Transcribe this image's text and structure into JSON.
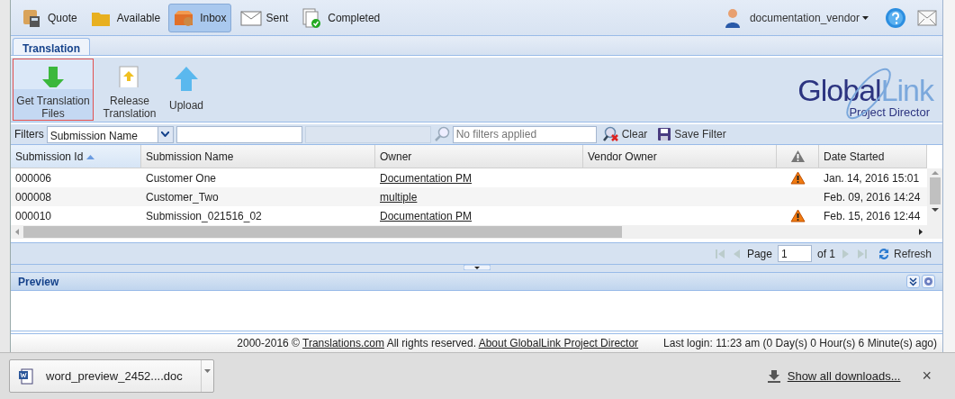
{
  "nav": {
    "items": [
      {
        "label": "Quote",
        "selected": false
      },
      {
        "label": "Available",
        "selected": false
      },
      {
        "label": "Inbox",
        "selected": true
      },
      {
        "label": "Sent",
        "selected": false
      },
      {
        "label": "Completed",
        "selected": false
      }
    ],
    "user": "documentation_vendor"
  },
  "tabs": [
    {
      "label": "Translation",
      "selected": true
    }
  ],
  "toolbar": {
    "buttons": [
      {
        "label": "Get Translation Files",
        "focused": true
      },
      {
        "label": "Release Translation",
        "focused": false
      },
      {
        "label": "Upload",
        "focused": false
      }
    ]
  },
  "logo": {
    "word_1": "Global",
    "word_2": "Link",
    "subtitle": "Project Director"
  },
  "filters": {
    "label": "Filters",
    "field_select": "Submission Name",
    "search_placeholder": "No filters applied",
    "clear": "Clear",
    "save": "Save Filter"
  },
  "table": {
    "columns": [
      {
        "label": "Submission Id",
        "sorted": true
      },
      {
        "label": "Submission Name",
        "sorted": false
      },
      {
        "label": "Owner",
        "sorted": false
      },
      {
        "label": "Vendor Owner",
        "sorted": false
      },
      {
        "kind": "warning",
        "sorted": false
      },
      {
        "label": "Date Started",
        "sorted": false
      }
    ],
    "rows": [
      {
        "id": "000006",
        "name": "Customer One",
        "owner": "Documentation PM",
        "warning": true,
        "date": "Jan. 14, 2016 15:01"
      },
      {
        "id": "000008",
        "name": "Customer_Two",
        "owner": "multiple",
        "warning": false,
        "date": "Feb. 09, 2016 14:24"
      },
      {
        "id": "000010",
        "name": "Submission_021516_02",
        "owner": "Documentation PM",
        "warning": true,
        "date": "Feb. 15, 2016 12:44"
      }
    ]
  },
  "pager": {
    "page_label": "Page",
    "page": "1",
    "of": "of 1",
    "refresh": "Refresh"
  },
  "preview": {
    "title": "Preview"
  },
  "footer": {
    "copyright": "2000-2016 ©",
    "link_1": "Translations.com",
    "rights": "All rights reserved.",
    "link_2": "About GlobalLink Project Director",
    "last_login": "Last login: 11:23 am (0 Day(s) 0 Hour(s) 6 Minute(s) ago)"
  },
  "downloads": {
    "file": "word_preview_2452....doc",
    "show_all": "Show all downloads...",
    "close": "×"
  }
}
